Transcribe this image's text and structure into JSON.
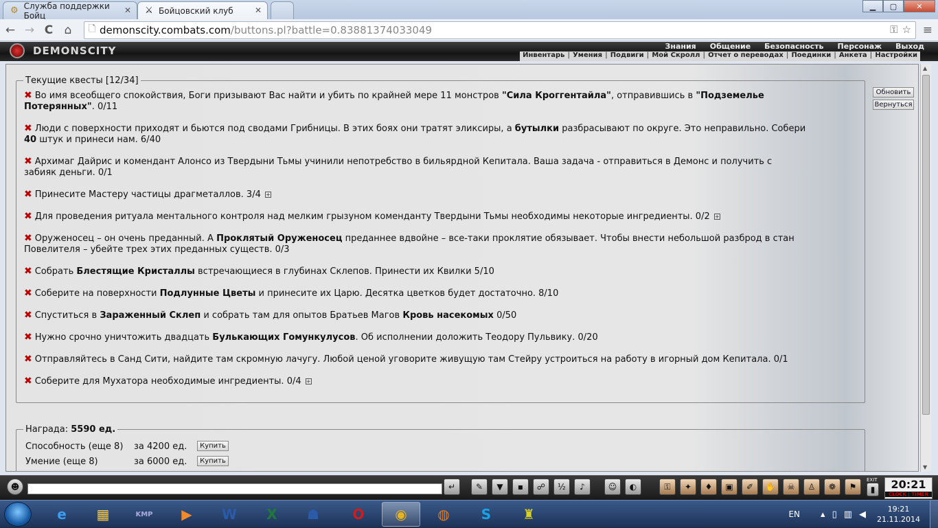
{
  "browser": {
    "tabs": [
      {
        "title": "Служба поддержки Бойц",
        "icon": "support-favicon",
        "active": false
      },
      {
        "title": "Бойцовский клуб",
        "icon": "crossed-swords-favicon",
        "active": true
      }
    ],
    "window_controls": {
      "minimize": "▁",
      "maximize": "▢",
      "close": "✕"
    },
    "url_host": "demonscity.combats.com",
    "url_path": "/buttons.pl?battle=0.83881374033049",
    "icons": {
      "back": "←",
      "forward": "→",
      "reload": "C",
      "home": "⌂",
      "key": "⚿",
      "star": "☆",
      "menu": "≡",
      "page": "🗋"
    }
  },
  "game": {
    "logo": "DEMONSCITY",
    "top_nav": [
      "Знания",
      "Общение",
      "Безопасность",
      "Персонаж",
      "Выход"
    ],
    "sub_nav": [
      "Инвентарь",
      "Умения",
      "Подвиги",
      "Мой Скролл",
      "Отчет о переводах",
      "Поединки",
      "Анкета",
      "Настройки"
    ],
    "quests_legend": "Текущие квесты [12/34]",
    "refresh_button": "Обновить",
    "back_button": "Вернуться",
    "quest_mark": "✖",
    "expand_mark": "+",
    "quests": [
      {
        "parts": [
          [
            "t",
            "Во имя всеобщего спокойствия, Боги призывают Вас найти и убить по крайней мере 11 монстров "
          ],
          [
            "b",
            "\"Сила Кроггентайла\""
          ],
          [
            "t",
            ", отправившись в "
          ],
          [
            "b",
            "\"Подземелье Потерянных\""
          ],
          [
            "t",
            ". 0/11"
          ]
        ],
        "expand": false
      },
      {
        "parts": [
          [
            "t",
            "Люди с поверхности приходят и бьются под сводами Грибницы. В этих боях они тратят эликсиры, а "
          ],
          [
            "b",
            "бутылки"
          ],
          [
            "t",
            " разбрасывают по округе. Это неправильно. Собери "
          ],
          [
            "b",
            "40"
          ],
          [
            "t",
            " штук и принеси нам. 6/40"
          ]
        ],
        "expand": false
      },
      {
        "parts": [
          [
            "t",
            "Архимаг Дайрис и комендант Алонсо из Твердыни Тьмы учинили непотребство в бильярдной Кепитала. Ваша задача - отправиться в Демонс и получить с забияк деньги. 0/1"
          ]
        ],
        "expand": false
      },
      {
        "parts": [
          [
            "t",
            "Принесите Мастеру частицы драгметаллов. 3/4"
          ]
        ],
        "expand": true
      },
      {
        "parts": [
          [
            "t",
            "Для проведения ритуала ментального контроля над мелким грызуном коменданту Твердыни Тьмы необходимы некоторые ингредиенты. 0/2"
          ]
        ],
        "expand": true
      },
      {
        "parts": [
          [
            "t",
            "Оруженосец – он очень преданный. А "
          ],
          [
            "b",
            "Проклятый Оруженосец"
          ],
          [
            "t",
            " преданнее вдвойне – все-таки проклятие обязывает. Чтобы внести небольшой разброд в стан Повелителя – убейте трех этих преданных существ. 0/3"
          ]
        ],
        "expand": false
      },
      {
        "parts": [
          [
            "t",
            "Собрать "
          ],
          [
            "b",
            "Блестящие Кристаллы"
          ],
          [
            "t",
            " встречающиеся в глубинах Склепов. Принести их Квилки 5/10"
          ]
        ],
        "expand": false
      },
      {
        "parts": [
          [
            "t",
            "Соберите на поверхности "
          ],
          [
            "b",
            "Подлунные Цветы"
          ],
          [
            "t",
            " и принесите их Царю. Десятка цветков будет достаточно. 8/10"
          ]
        ],
        "expand": false
      },
      {
        "parts": [
          [
            "t",
            "Спуститься в "
          ],
          [
            "b",
            "Зараженный Склеп"
          ],
          [
            "t",
            " и собрать там для опытов Братьев Магов "
          ],
          [
            "b",
            "Кровь насекомых"
          ],
          [
            "t",
            " 0/50"
          ]
        ],
        "expand": false
      },
      {
        "parts": [
          [
            "t",
            "Нужно срочно уничтожить двадцать "
          ],
          [
            "b",
            "Булькающих Гомункулусов"
          ],
          [
            "t",
            ". Об исполнении доложить Теодору Пульвику. 0/20"
          ]
        ],
        "expand": false
      },
      {
        "parts": [
          [
            "t",
            "Отправляйтесь в Санд Сити, найдите там скромную лачугу. Любой ценой уговорите живущую там Стейру устроиться на работу в игорный дом Кепитала. 0/1"
          ]
        ],
        "expand": false
      },
      {
        "parts": [
          [
            "t",
            "Соберите для Мухатора необходимые ингредиенты. 0/4"
          ]
        ],
        "expand": true
      }
    ],
    "reward_label": "Награда:",
    "reward_value": "5590 ед.",
    "reward_rows": [
      {
        "label": "Способность (еще 8)",
        "price": "за 4200 ед.",
        "button": "Купить"
      },
      {
        "label": "Умение (еще 8)",
        "price": "за 6000 ед.",
        "button": "Купить"
      }
    ],
    "clock": {
      "time": "20:21",
      "label": "CLOCK | TIMER",
      "exit": "EXIT"
    }
  },
  "taskbar": {
    "lang": "EN",
    "time": "19:21",
    "date": "21.11.2014",
    "apps": [
      {
        "name": "ie",
        "glyph": "e",
        "color": "#3b9cf0"
      },
      {
        "name": "explorer",
        "glyph": "▦",
        "color": "#f0c64a"
      },
      {
        "name": "kmplayer",
        "glyph": "KMP",
        "color": "#aad"
      },
      {
        "name": "media",
        "glyph": "▶",
        "color": "#f08a2a"
      },
      {
        "name": "word",
        "glyph": "W",
        "color": "#2a5aa8"
      },
      {
        "name": "excel",
        "glyph": "X",
        "color": "#1f7a3a"
      },
      {
        "name": "app",
        "glyph": "☗",
        "color": "#2a5aa8"
      },
      {
        "name": "opera",
        "glyph": "O",
        "color": "#d21b1b"
      },
      {
        "name": "chrome",
        "glyph": "◉",
        "color": "#e6b31e"
      },
      {
        "name": "firefox",
        "glyph": "◍",
        "color": "#e87a1a"
      },
      {
        "name": "skype",
        "glyph": "S",
        "color": "#1aa3e6"
      },
      {
        "name": "game",
        "glyph": "♜",
        "color": "#d8d020"
      }
    ]
  }
}
